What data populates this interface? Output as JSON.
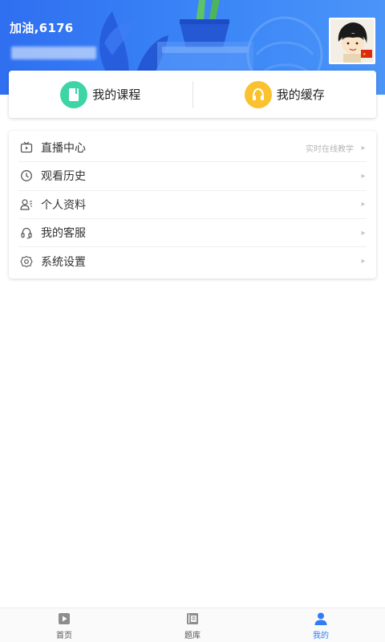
{
  "header": {
    "greeting": "加油,6176",
    "bg_color": "#3a86f7"
  },
  "quick_actions": [
    {
      "label": "我的课程",
      "icon": "book-icon",
      "color": "#3dd4a6"
    },
    {
      "label": "我的缓存",
      "icon": "headphones-icon",
      "color": "#f9c22e"
    }
  ],
  "menu": [
    {
      "label": "直播中心",
      "hint": "实时在线教学",
      "icon": "tv-icon"
    },
    {
      "label": "观看历史",
      "hint": "",
      "icon": "clock-icon"
    },
    {
      "label": "个人资料",
      "hint": "",
      "icon": "profile-icon"
    },
    {
      "label": "我的客服",
      "hint": "",
      "icon": "headset-icon"
    },
    {
      "label": "系统设置",
      "hint": "",
      "icon": "gear-icon"
    }
  ],
  "bottom_nav": [
    {
      "label": "首页",
      "icon": "video-icon",
      "active": false
    },
    {
      "label": "题库",
      "icon": "question-book-icon",
      "active": false
    },
    {
      "label": "我的",
      "icon": "person-icon",
      "active": true
    }
  ],
  "colors": {
    "accent": "#2f7cf6",
    "divider": "#efefef"
  }
}
